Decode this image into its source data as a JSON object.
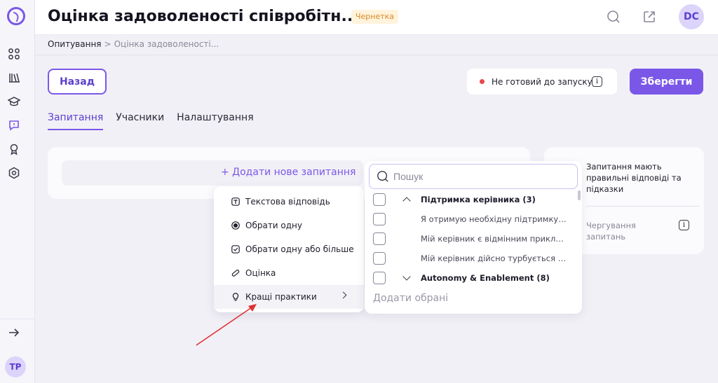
{
  "header": {
    "title": "Оцінка задоволеності співробітн...",
    "status_badge": "Чернетка",
    "avatar_initials": "DC"
  },
  "breadcrumb": {
    "root": "Опитування",
    "separator": ">",
    "current": "Оцінка задоволеності..."
  },
  "actions": {
    "back_label": "Назад",
    "readiness_status": "Не готовий до запуску",
    "save_label": "Зберегти"
  },
  "tabs": [
    {
      "label": "Запитання",
      "active": true
    },
    {
      "label": "Учасники",
      "active": false
    },
    {
      "label": "Налаштування",
      "active": false
    }
  ],
  "main": {
    "add_question_label": "+ Додати нове запитання"
  },
  "question_type_menu": {
    "items": [
      {
        "label": "Текстова відповідь",
        "icon": "text-answer-icon"
      },
      {
        "label": "Обрати одну",
        "icon": "radio-icon"
      },
      {
        "label": "Обрати одну або більше",
        "icon": "checkbox-icon"
      },
      {
        "label": "Оцінка",
        "icon": "rating-icon"
      },
      {
        "label": "Кращі практики",
        "icon": "lightbulb-icon",
        "has_submenu": true,
        "hovered": true
      }
    ]
  },
  "best_practices": {
    "search_placeholder": "Пошук",
    "rows": [
      {
        "type": "group",
        "label": "Підтримка керівника (3)",
        "expanded": true
      },
      {
        "type": "item",
        "label": "Я отримую необхідну підтримку в..."
      },
      {
        "type": "item",
        "label": "Мій керівник є відмінним приклад..."
      },
      {
        "type": "item",
        "label": "Мій керівник дійсно турбується п..."
      },
      {
        "type": "group",
        "label": "Autonomy & Enablement (8)",
        "expanded": false
      }
    ],
    "add_selected_label": "Додати обрані"
  },
  "settings_panel": {
    "correct_answers_text": "Запитання мають правильні відповіді та підказки",
    "rotation_text": "Чергування запитань"
  },
  "sidebar": {
    "icons": [
      "dashboard-icon",
      "library-icon",
      "learning-icon",
      "surveys-icon",
      "achievements-icon",
      "settings-icon"
    ],
    "expand_icon": "arrow-right-icon",
    "user_initials": "TP"
  },
  "colors": {
    "accent": "#7b57e8",
    "draft_badge_bg": "#fff3dc",
    "draft_badge_text": "#d9892a",
    "status_dot": "#e5484d",
    "annotation_arrow": "#e03030"
  }
}
